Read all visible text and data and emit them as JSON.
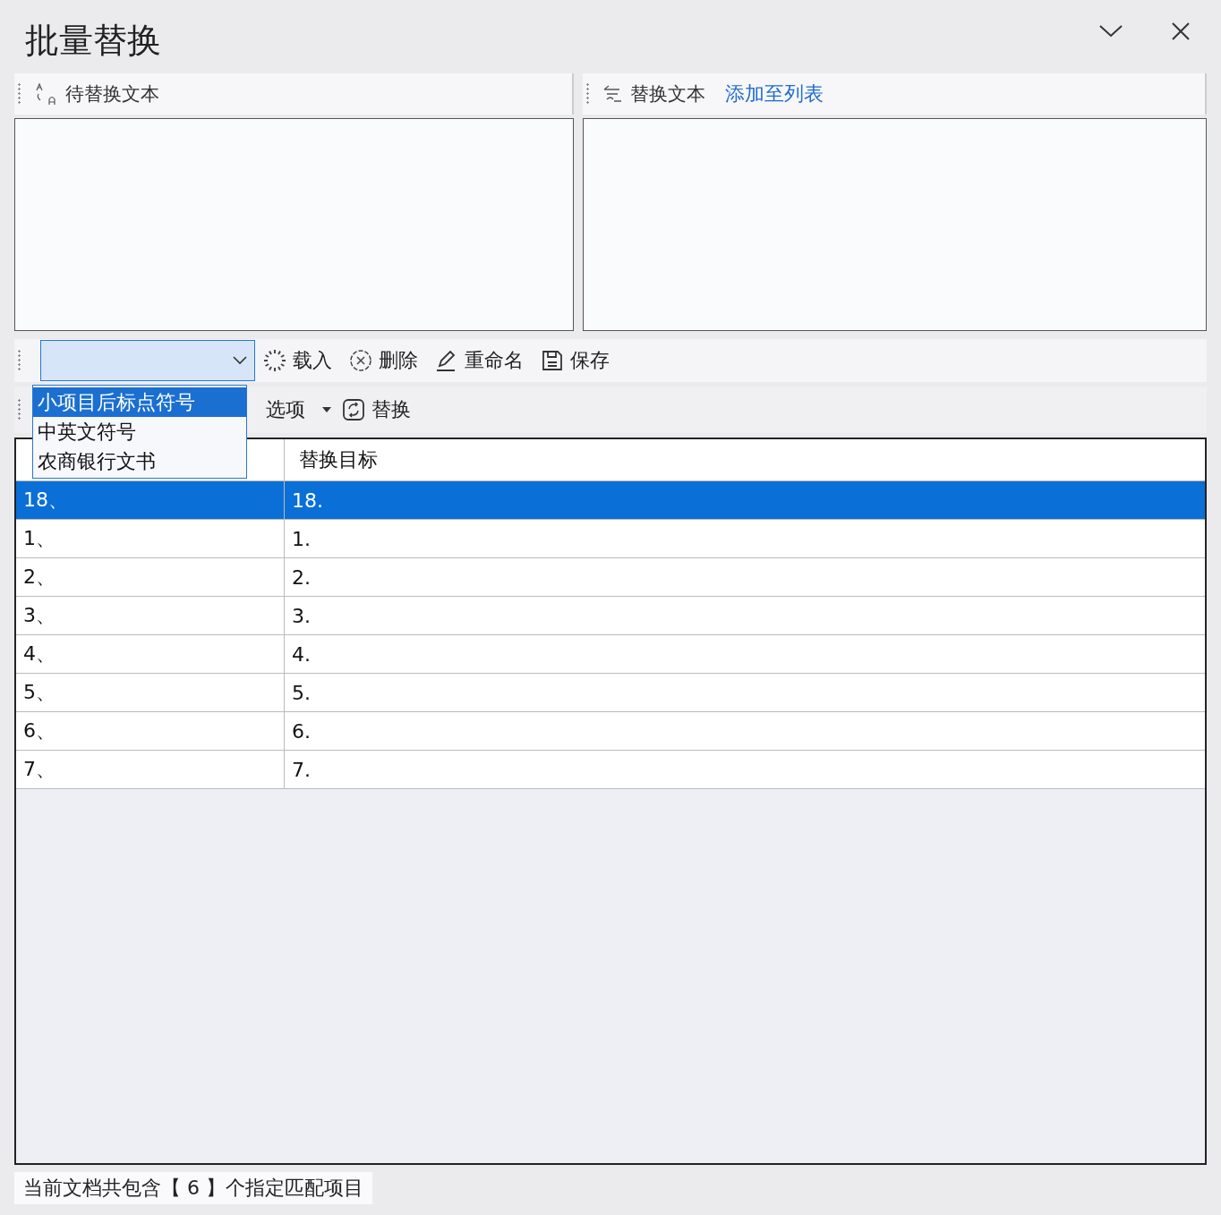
{
  "window": {
    "title": "批量替换"
  },
  "source_panel": {
    "title": "待替换文本"
  },
  "target_panel": {
    "title": "替换文本",
    "link": "添加至列表"
  },
  "toolbar": [
    {
      "kind": "load",
      "label": "载入"
    },
    {
      "kind": "delete",
      "label": "删除"
    },
    {
      "kind": "rename",
      "label": "重命名"
    },
    {
      "kind": "save",
      "label": "保存"
    }
  ],
  "preset_dropdown": {
    "expanded": true,
    "options": [
      {
        "label": "小项目后标点符号",
        "selected": true
      },
      {
        "label": "中英文符号",
        "selected": false
      },
      {
        "label": "农商银行文书",
        "selected": false
      }
    ]
  },
  "toolbar_2": {
    "options_label": "选项",
    "replace_label": "替换"
  },
  "table": {
    "columns": [
      "",
      "替换目标"
    ],
    "rows": [
      {
        "cells": [
          "18、",
          "18."
        ],
        "selected": true
      },
      {
        "cells": [
          "1、",
          "1."
        ],
        "selected": false
      },
      {
        "cells": [
          "2、",
          "2."
        ],
        "selected": false
      },
      {
        "cells": [
          "3、",
          "3."
        ],
        "selected": false
      },
      {
        "cells": [
          "4、",
          "4."
        ],
        "selected": false
      },
      {
        "cells": [
          "5、",
          "5."
        ],
        "selected": false
      },
      {
        "cells": [
          "6、",
          "6."
        ],
        "selected": false
      },
      {
        "cells": [
          "7、",
          "7."
        ],
        "selected": false
      }
    ]
  },
  "status_bar": "当前文档共包含【 6 】个指定匹配项目"
}
